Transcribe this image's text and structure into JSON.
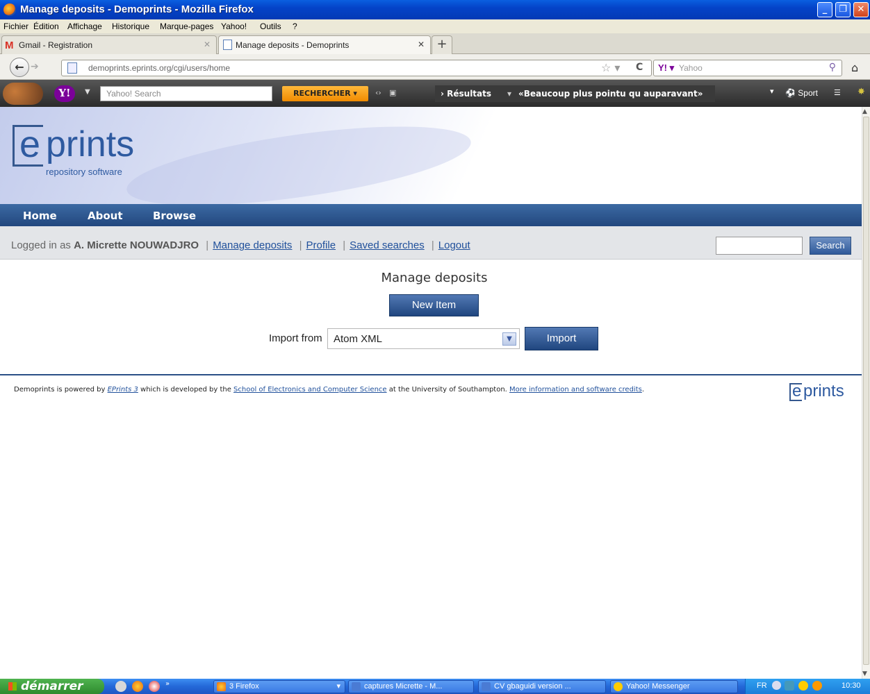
{
  "window": {
    "title": "Manage deposits - Demoprints - Mozilla Firefox"
  },
  "menu": [
    "Fichier",
    "Édition",
    "Affichage",
    "Historique",
    "Marque-pages",
    "Yahoo!",
    "Outils",
    "?"
  ],
  "tabs": [
    {
      "label": "Gmail - Registration",
      "active": false
    },
    {
      "label": "Manage deposits - Demoprints",
      "active": true
    }
  ],
  "nav": {
    "url": "demoprints.eprints.org/cgi/users/home",
    "search_placeholder": "Yahoo"
  },
  "yahoo_toolbar": {
    "search_placeholder": "Yahoo! Search",
    "search_button": "RECHERCHER",
    "results": "› Résultats",
    "headline": "«Beaucoup plus pointu qu auparavant»",
    "sport": "Sport"
  },
  "site": {
    "logo_text": "prints",
    "logo_e": "e",
    "logo_sub": "repository software",
    "nav": [
      "Home",
      "About",
      "Browse"
    ],
    "user_prefix": "Logged in as",
    "user_name": "A. Micrette NOUWADJRO",
    "user_links": [
      "Manage deposits",
      "Profile",
      "Saved searches",
      "Logout"
    ],
    "search_button": "Search"
  },
  "main": {
    "title": "Manage deposits",
    "new_item": "New Item",
    "import_label": "Import from",
    "import_value": "Atom XML",
    "import_button": "Import"
  },
  "footer": {
    "part1": "Demoprints is powered by",
    "eprints_link": "EPrints 3",
    "part2": "which is developed by the",
    "school_link": "School of Electronics and Computer Science",
    "part3": "at the University of Southampton.",
    "credits_link": "More information and software credits",
    "end": "."
  },
  "taskbar": {
    "start": "démarrer",
    "items": [
      "3 Firefox",
      "captures Micrette - M...",
      "CV gbaguidi version ...",
      "Yahoo! Messenger"
    ],
    "lang": "FR",
    "time": "10:30"
  }
}
